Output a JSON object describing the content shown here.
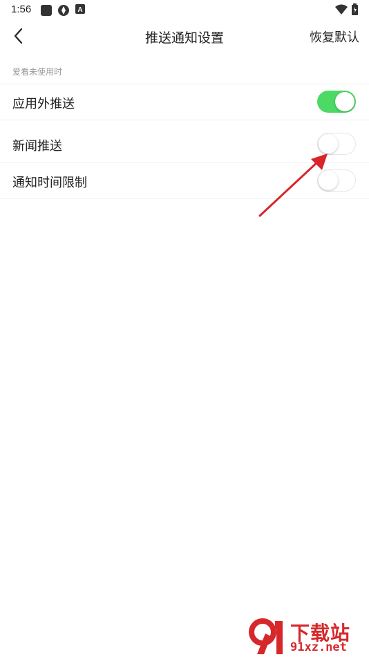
{
  "status_bar": {
    "time": "1:56",
    "icons": [
      "app-square-icon",
      "shutter-icon",
      "a-letter-icon"
    ],
    "right_icons": [
      "wifi-icon",
      "battery-icon"
    ]
  },
  "nav": {
    "back_icon": "chevron-left-icon",
    "title": "推送通知设置",
    "reset_label": "恢复默认"
  },
  "section": {
    "header": "爱看未使用时"
  },
  "settings": [
    {
      "label": "应用外推送",
      "enabled": true
    },
    {
      "label": "新闻推送",
      "enabled": false
    },
    {
      "label": "通知时间限制",
      "enabled": false
    }
  ],
  "colors": {
    "toggle_on": "#4cd964",
    "annotation_arrow": "#d9252a",
    "watermark": "#d6282b"
  },
  "watermark": {
    "logo": "91",
    "title": "下载站",
    "url": "91xz.net"
  }
}
